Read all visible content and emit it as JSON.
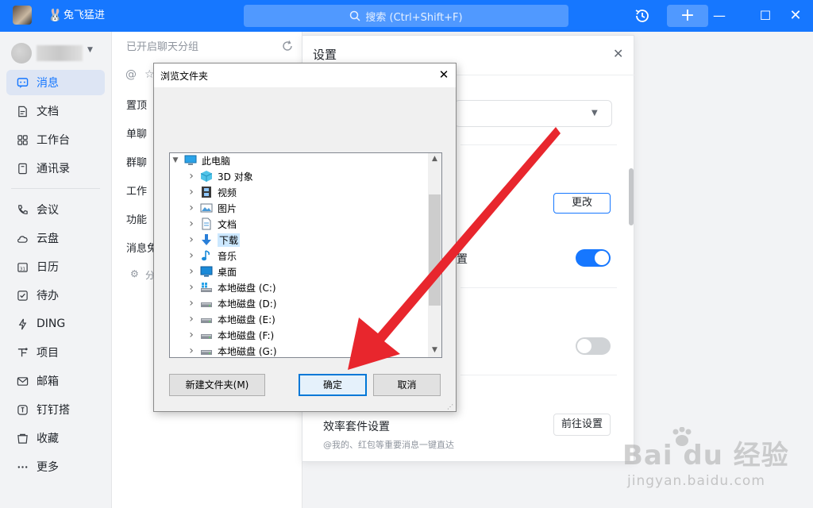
{
  "app": {
    "org_name": "兔飞猛进",
    "search_placeholder": "搜索 (Ctrl+Shift+F)",
    "add_label": "+"
  },
  "sidebar": {
    "items": [
      {
        "label": "消息",
        "icon": "message-icon",
        "active": true
      },
      {
        "label": "文档",
        "icon": "document-icon"
      },
      {
        "label": "工作台",
        "icon": "workbench-icon"
      },
      {
        "label": "通讯录",
        "icon": "contacts-icon"
      },
      {
        "label": "会议",
        "icon": "phone-icon"
      },
      {
        "label": "云盘",
        "icon": "cloud-icon"
      },
      {
        "label": "日历",
        "icon": "calendar-icon"
      },
      {
        "label": "待办",
        "icon": "todo-icon"
      },
      {
        "label": "DING",
        "icon": "ding-icon"
      },
      {
        "label": "项目",
        "icon": "project-icon"
      },
      {
        "label": "邮箱",
        "icon": "mail-icon"
      },
      {
        "label": "钉钉搭",
        "icon": "builder-icon"
      },
      {
        "label": "收藏",
        "icon": "favorite-icon"
      },
      {
        "label": "更多",
        "icon": "more-icon"
      }
    ]
  },
  "chatlist": {
    "hint": "已开启聊天分组",
    "groups": [
      "置顶",
      "单聊",
      "群聊",
      "工作",
      "功能",
      "消息免"
    ],
    "footer": "分"
  },
  "settings": {
    "title": "设置",
    "change_label": "更改",
    "partial_text": "置",
    "toggle1_on": true,
    "toggle2_on": false,
    "efficiency_title": "效率套件设置",
    "efficiency_sub": "@我的、红包等重要消息一键直达",
    "goto_label": "前往设置"
  },
  "dialog": {
    "title": "浏览文件夹",
    "tree": [
      {
        "label": "此电脑",
        "icon": "computer-icon",
        "root": true
      },
      {
        "label": "3D 对象",
        "icon": "3d-objects-icon"
      },
      {
        "label": "视频",
        "icon": "video-icon"
      },
      {
        "label": "图片",
        "icon": "picture-icon"
      },
      {
        "label": "文档",
        "icon": "document-icon"
      },
      {
        "label": "下载",
        "icon": "download-icon",
        "selected": true
      },
      {
        "label": "音乐",
        "icon": "music-icon"
      },
      {
        "label": "桌面",
        "icon": "desktop-icon"
      },
      {
        "label": "本地磁盘 (C:)",
        "icon": "system-drive-icon"
      },
      {
        "label": "本地磁盘 (D:)",
        "icon": "drive-icon"
      },
      {
        "label": "本地磁盘 (E:)",
        "icon": "drive-icon"
      },
      {
        "label": "本地磁盘 (F:)",
        "icon": "drive-icon"
      },
      {
        "label": "本地磁盘 (G:)",
        "icon": "drive-icon"
      }
    ],
    "new_folder_label": "新建文件夹(M)",
    "ok_label": "确定",
    "cancel_label": "取消"
  },
  "watermark": {
    "logo": "Bai du 经验",
    "url": "jingyan.baidu.com"
  },
  "colors": {
    "brand": "#1677ff",
    "annotation_arrow": "#e8262d"
  }
}
